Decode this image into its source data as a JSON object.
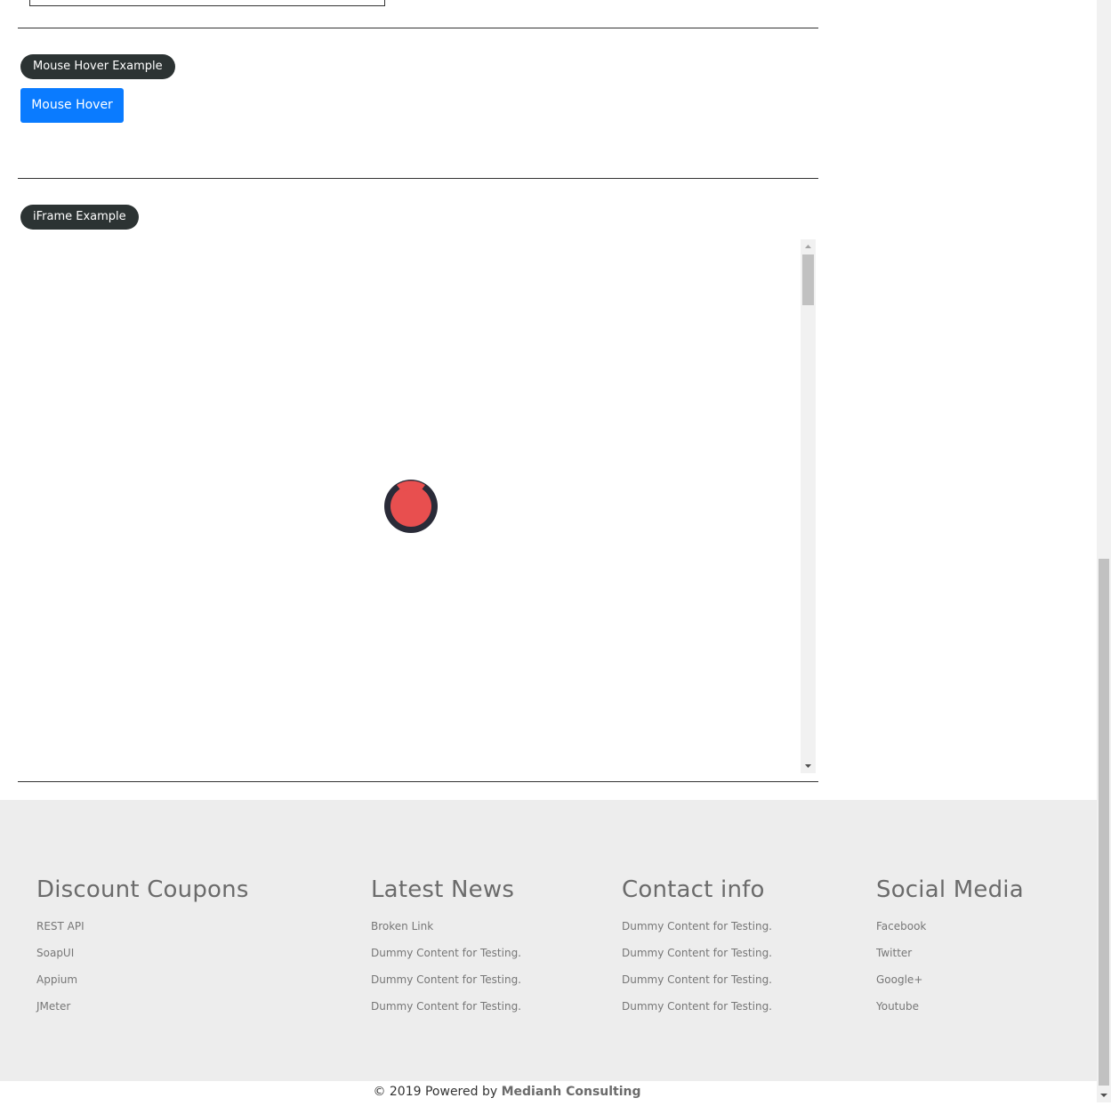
{
  "mouse_hover": {
    "section_label": "Mouse Hover Example",
    "button_label": "Mouse Hover"
  },
  "iframe": {
    "section_label": "iFrame Example"
  },
  "footer": {
    "columns": [
      {
        "title": "Discount Coupons",
        "links": [
          "REST API",
          "SoapUI",
          "Appium",
          "JMeter"
        ]
      },
      {
        "title": "Latest News",
        "links": [
          "Broken Link",
          "Dummy Content for Testing.",
          "Dummy Content for Testing.",
          "Dummy Content for Testing."
        ]
      },
      {
        "title": "Contact info",
        "links": [
          "Dummy Content for Testing.",
          "Dummy Content for Testing.",
          "Dummy Content for Testing.",
          "Dummy Content for Testing."
        ]
      },
      {
        "title": "Social Media",
        "links": [
          "Facebook",
          "Twitter",
          "Google+",
          "Youtube"
        ]
      }
    ]
  },
  "copyright": {
    "text": "© 2019 Powered by ",
    "brand": "Medianh Consulting"
  },
  "colors": {
    "pill_bg": "#2c3333",
    "primary_button": "#0a7bff",
    "footer_bg": "#ededed",
    "loader_ring": "#2a2b38",
    "loader_core": "#e84f4f"
  },
  "icons": {
    "loader": "loading-spinner-icon",
    "scroll_up": "scroll-up-arrow-icon",
    "scroll_down": "scroll-down-arrow-icon"
  }
}
